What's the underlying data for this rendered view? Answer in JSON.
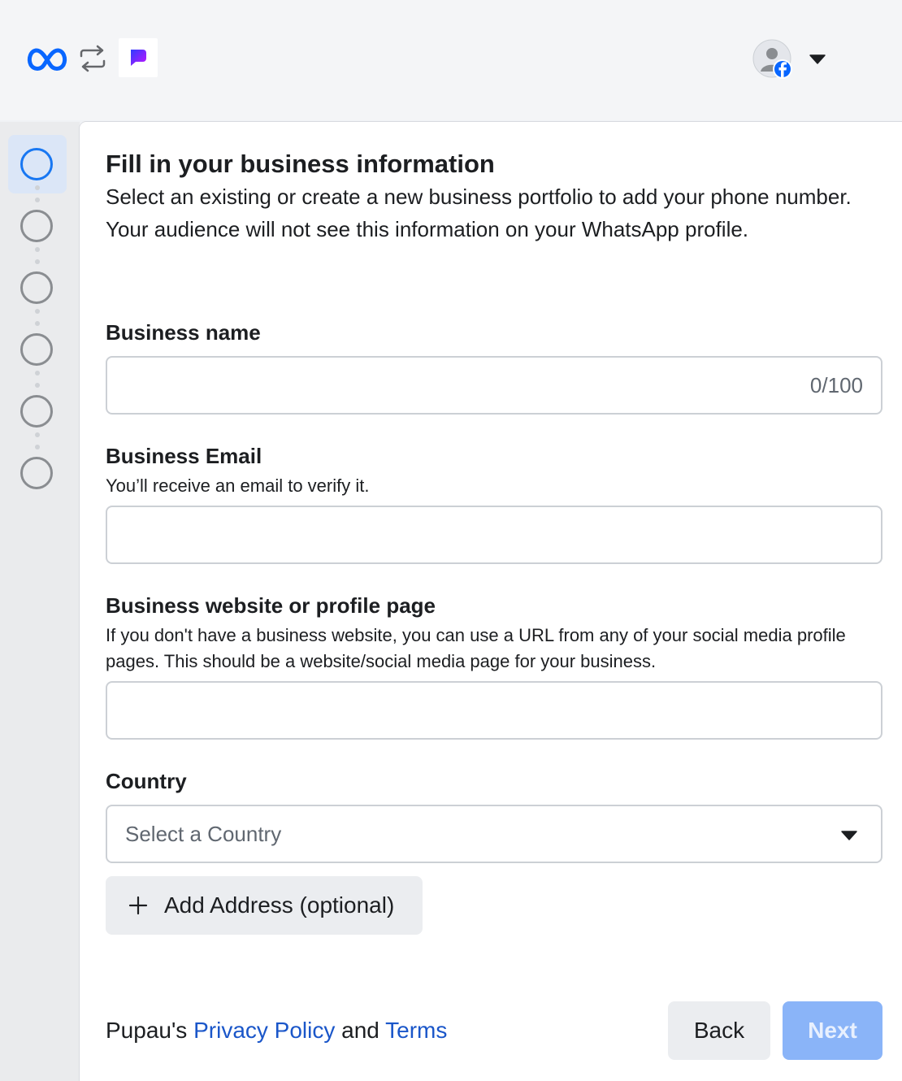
{
  "header": {
    "meta_logo": "meta-logo-icon",
    "swap": "swap-arrows-icon",
    "app_logo": "pupau-logo-icon",
    "avatar": "facebook-avatar-icon",
    "account_menu": "caret-down-icon"
  },
  "stepper": {
    "steps": 6,
    "active_step": 1
  },
  "form": {
    "title": "Fill in your business information",
    "intro": "Select an existing or create a new business portfolio to add your phone number. Your audience will not see this information on your WhatsApp profile.",
    "business_name": {
      "label": "Business name",
      "value": "",
      "counter": "0/100"
    },
    "business_email": {
      "label": "Business Email",
      "help": "You’ll receive an email to verify it.",
      "value": ""
    },
    "business_website": {
      "label": "Business website or profile page",
      "help": "If you don't have a business website, you can use a URL from any of your social media profile pages. This should be a website/social media page for your business.",
      "value": ""
    },
    "country": {
      "label": "Country",
      "selected": "Select a Country"
    },
    "add_address_label": "Add Address (optional)"
  },
  "footer": {
    "prefix": "Pupau's",
    "privacy_link": "Privacy Policy",
    "and": "and",
    "terms_link": "Terms",
    "back_label": "Back",
    "next_label": "Next"
  },
  "colors": {
    "accent": "#1877f2",
    "link": "#1a56c9",
    "next_disabled": "#8ab4f8"
  }
}
